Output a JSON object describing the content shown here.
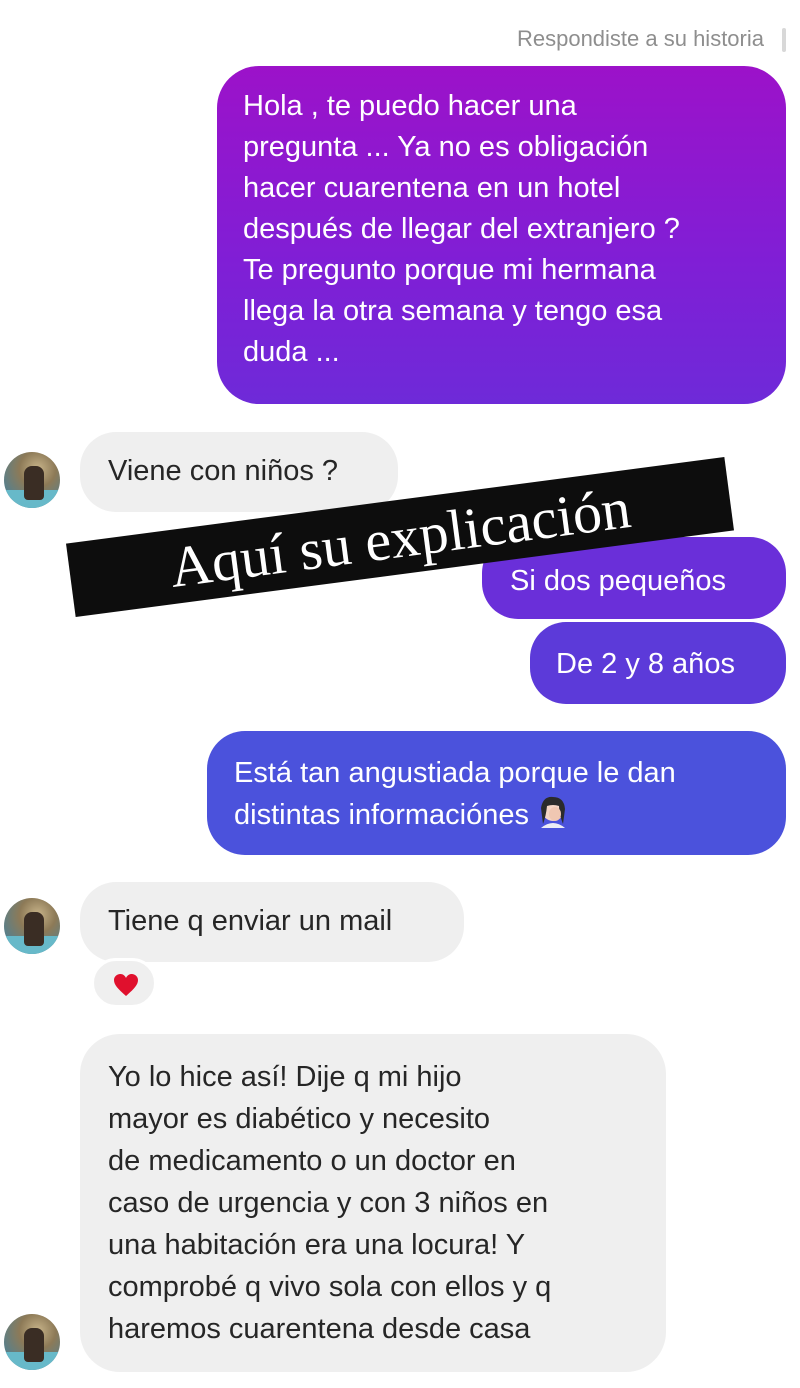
{
  "thread": {
    "story_reply_note": "Respondiste a su historia"
  },
  "messages": {
    "out_1": "Hola , te puedo hacer una\npregunta ... Ya no es obligación\nhacer cuarentena en un hotel\ndespués de llegar del extranjero ?\nTe pregunto porque mi hermana\nllega la otra semana y tengo esa\nduda ...",
    "in_1": "Viene con niños ?",
    "out_2": "Si dos pequeños",
    "out_3": "De 2 y 8 años",
    "out_4": "Está tan angustiada porque le dan\ndistintas informaciónes",
    "in_2": "Tiene q enviar un mail",
    "in_3": "Yo lo hice así! Dije q mi hijo\nmayor es diabético y necesito\nde medicamento o un doctor en\ncaso de urgencia y con 3 niños en\nuna habitación era una locura! Y\ncomprobé q vivo sola con ellos y q\nharemos cuarentena desde casa"
  },
  "reaction": {
    "icon": "red-heart-icon",
    "color": "#e0102d"
  },
  "emoji": {
    "icon": "woman-facepalming-icon"
  },
  "overlay": {
    "caption": "Aquí su explicación"
  },
  "colors": {
    "outgoing_top": "#9c12c9",
    "outgoing_bottom": "#4b52dc",
    "incoming_bg": "#efefef"
  }
}
